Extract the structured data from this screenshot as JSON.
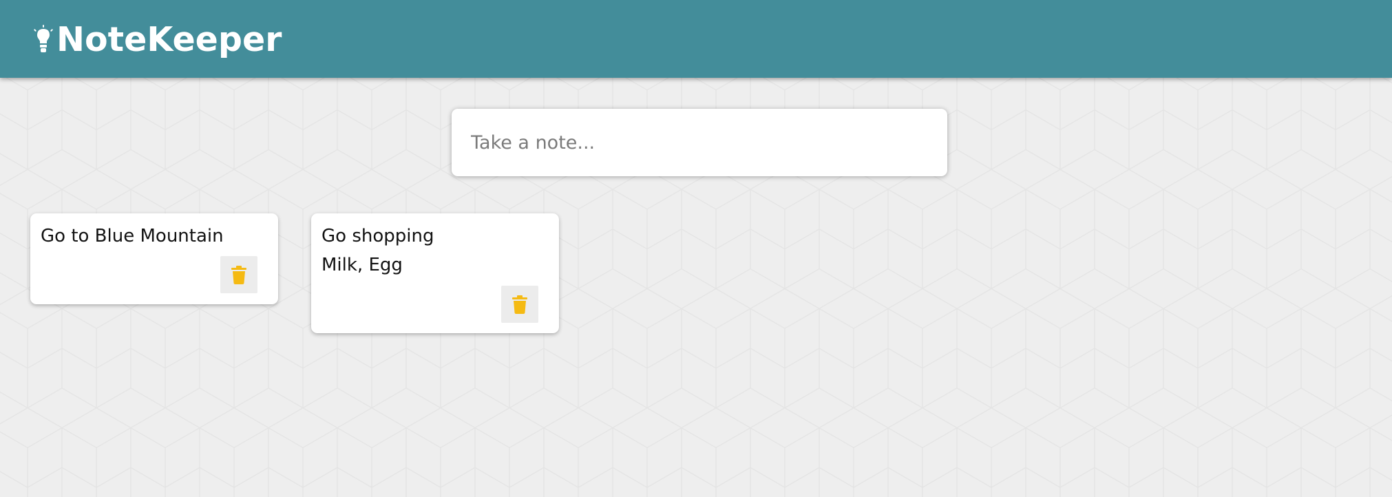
{
  "app": {
    "title": "NoteKeeper",
    "header_color": "#438d9a",
    "logo_icon": "lightbulb-icon"
  },
  "compose": {
    "placeholder": "Take a note..."
  },
  "notes": [
    {
      "title": "Go to Blue Mountain",
      "content": "",
      "delete_icon": "trash-icon"
    },
    {
      "title": "Go shopping",
      "content": "Milk, Egg",
      "delete_icon": "trash-icon"
    }
  ],
  "colors": {
    "background": "#eeeeee",
    "card": "#ffffff",
    "delete_icon": "#f5ba13",
    "delete_button_bg": "#ececec"
  }
}
